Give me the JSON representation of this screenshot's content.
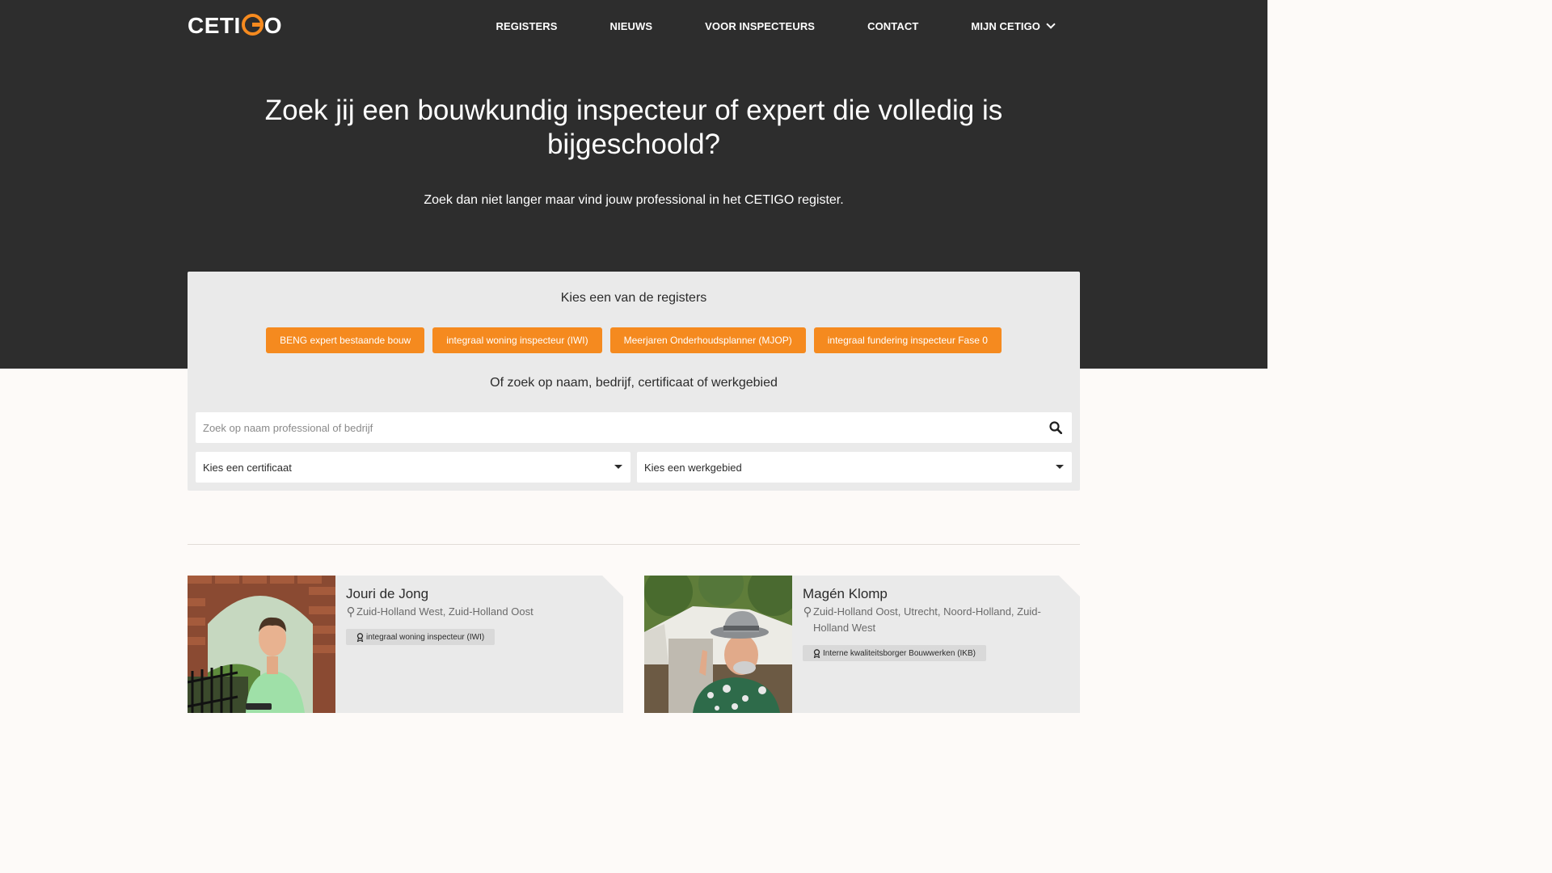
{
  "header": {
    "logo_text_pre": "CETI",
    "logo_text_post": "O",
    "nav": [
      {
        "label": "REGISTERS"
      },
      {
        "label": "NIEUWS"
      },
      {
        "label": "VOOR INSPECTEURS"
      },
      {
        "label": "CONTACT"
      },
      {
        "label": "MIJN CETIGO",
        "icon": "chevron-down-icon"
      }
    ]
  },
  "hero": {
    "title": "Zoek jij een bouwkundig inspecteur of expert die volledig is bijgeschoold?",
    "subtitle": "Zoek dan niet langer maar vind jouw professional in het CETIGO register."
  },
  "search_panel": {
    "registers_heading": "Kies een van de registers",
    "registers": [
      {
        "label": "BENG expert bestaande bouw"
      },
      {
        "label": "integraal woning inspecteur (IWI)"
      },
      {
        "label": "Meerjaren Onderhoudsplanner (MJOP)"
      },
      {
        "label": "integraal fundering inspecteur Fase 0"
      }
    ],
    "search_heading": "Of zoek op naam, bedrijf, certificaat of werkgebied",
    "search_placeholder": "Zoek op naam professional of bedrijf",
    "search_icon": "search-icon",
    "certificate_select": "Kies een certificaat",
    "area_select": "Kies een werkgebied"
  },
  "results": [
    {
      "name": "Jouri de Jong",
      "location": "Zuid-Holland West, Zuid-Holland Oost",
      "certificate": "integraal woning inspecteur (IWI)"
    },
    {
      "name": "Magén Klomp",
      "location": "Zuid-Holland Oost, Utrecht, Noord-Holland, Zuid-Holland West",
      "certificate": "Interne kwaliteitsborger Bouwwerken (IKB)"
    }
  ],
  "colors": {
    "accent": "#f58a1f",
    "hero_bg": "#2d2d2d",
    "panel_bg": "#eaeaea",
    "page_bg": "#fdfaf8"
  }
}
